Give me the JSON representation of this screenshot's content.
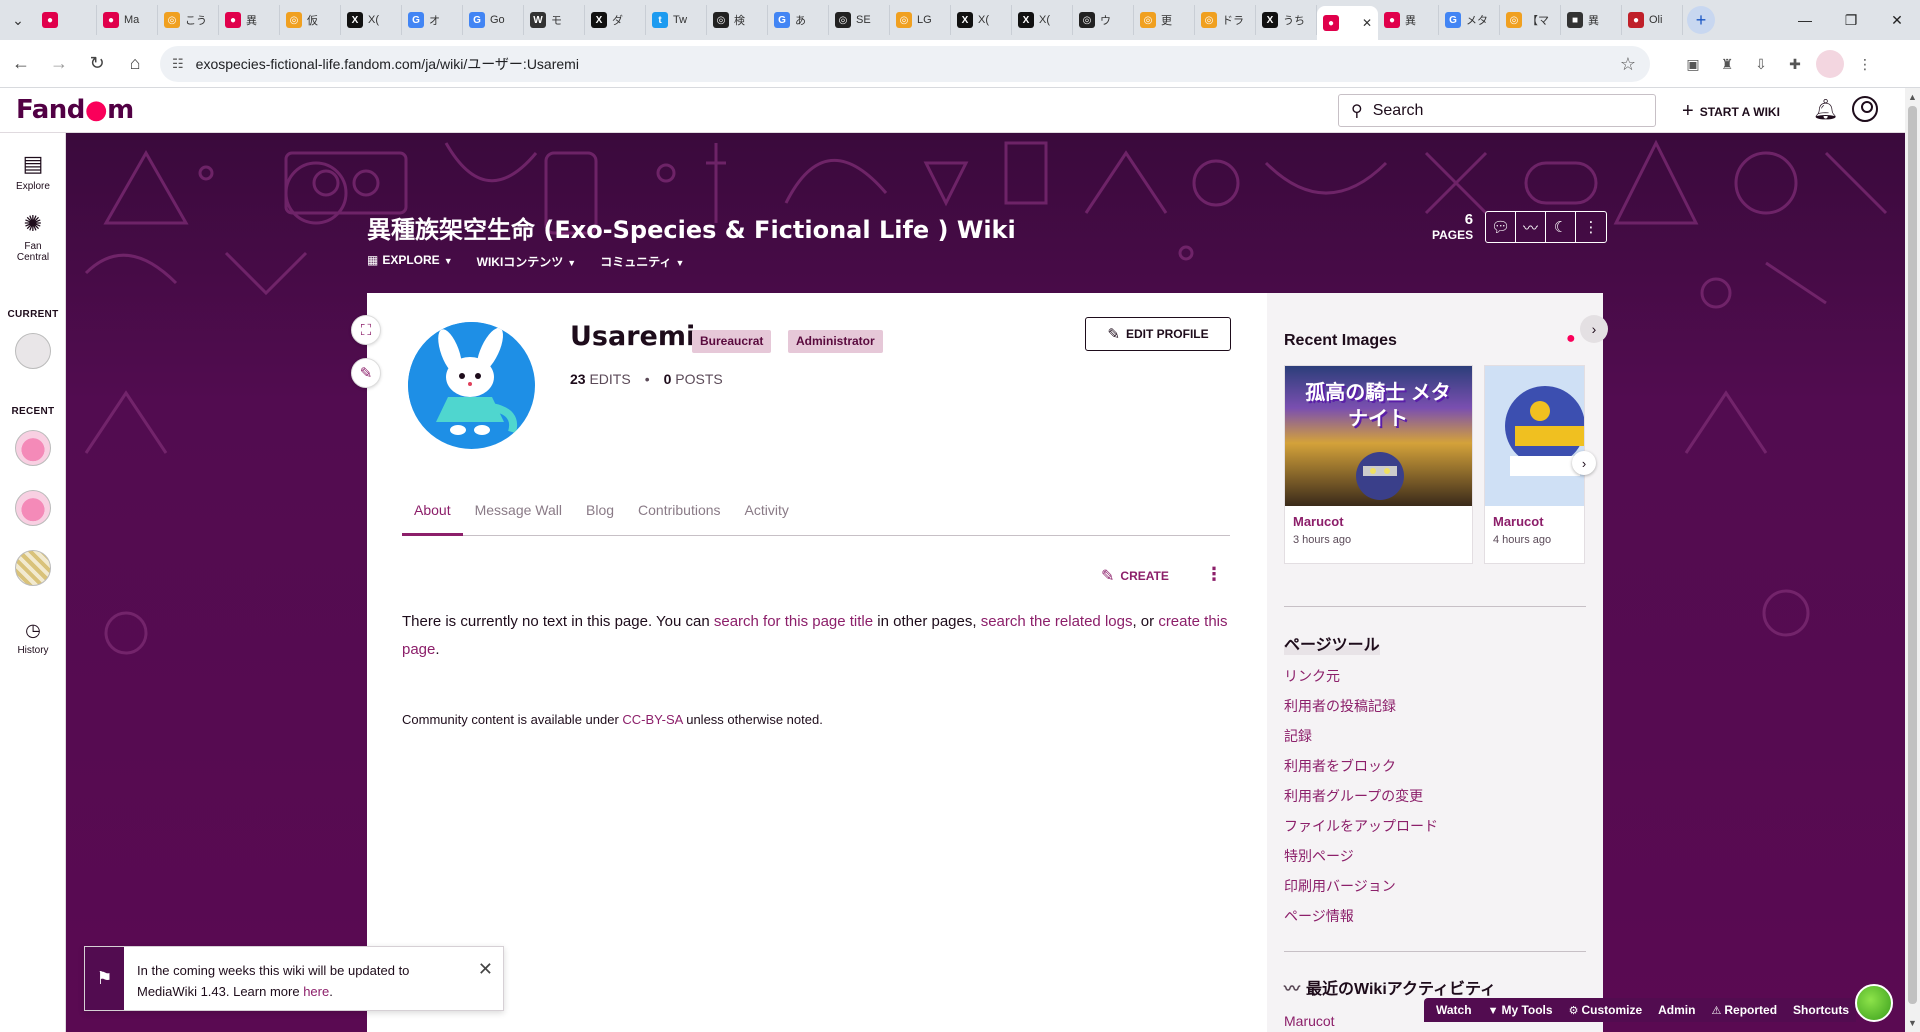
{
  "browser": {
    "tabs": [
      {
        "label": "",
        "fav_color": "#e0004b",
        "fav_glyph": "●"
      },
      {
        "label": "Ma",
        "fav_color": "#e0004b",
        "fav_glyph": "●"
      },
      {
        "label": "こう",
        "fav_color": "#f0a020",
        "fav_glyph": "◎"
      },
      {
        "label": "異",
        "fav_color": "#e0004b",
        "fav_glyph": "●"
      },
      {
        "label": "仮",
        "fav_color": "#f0a020",
        "fav_glyph": "◎"
      },
      {
        "label": "X(",
        "fav_color": "#111111",
        "fav_glyph": "X"
      },
      {
        "label": "オ",
        "fav_color": "#4285f4",
        "fav_glyph": "G"
      },
      {
        "label": "Go",
        "fav_color": "#4285f4",
        "fav_glyph": "G"
      },
      {
        "label": "モ",
        "fav_color": "#333333",
        "fav_glyph": "W"
      },
      {
        "label": "ダ",
        "fav_color": "#111111",
        "fav_glyph": "X"
      },
      {
        "label": "Tw",
        "fav_color": "#1d9bf0",
        "fav_glyph": "t"
      },
      {
        "label": "検",
        "fav_color": "#222222",
        "fav_glyph": "◎"
      },
      {
        "label": "あ",
        "fav_color": "#4285f4",
        "fav_glyph": "G"
      },
      {
        "label": "SE",
        "fav_color": "#222222",
        "fav_glyph": "◎"
      },
      {
        "label": "LG",
        "fav_color": "#f0a020",
        "fav_glyph": "◎"
      },
      {
        "label": "X(",
        "fav_color": "#111111",
        "fav_glyph": "X"
      },
      {
        "label": "X(",
        "fav_color": "#111111",
        "fav_glyph": "X"
      },
      {
        "label": "ウ",
        "fav_color": "#222222",
        "fav_glyph": "◎"
      },
      {
        "label": "更",
        "fav_color": "#f0a020",
        "fav_glyph": "◎"
      },
      {
        "label": "ドラ",
        "fav_color": "#f0a020",
        "fav_glyph": "◎"
      },
      {
        "label": "うち",
        "fav_color": "#111111",
        "fav_glyph": "X"
      },
      {
        "label": "",
        "fav_color": "#e0004b",
        "fav_glyph": "●",
        "active": true
      },
      {
        "label": "異",
        "fav_color": "#e0004b",
        "fav_glyph": "●"
      },
      {
        "label": "メタ",
        "fav_color": "#4285f4",
        "fav_glyph": "G"
      },
      {
        "label": "【マ",
        "fav_color": "#f0a020",
        "fav_glyph": "◎"
      },
      {
        "label": "異",
        "fav_color": "#333333",
        "fav_glyph": "■"
      },
      {
        "label": "Oli",
        "fav_color": "#c0202a",
        "fav_glyph": "●"
      }
    ],
    "url": "exospecies-fictional-life.fandom.com/ja/wiki/ユーザー:Usaremi"
  },
  "fandom": {
    "logo": "Fandom",
    "search_placeholder": "Search",
    "start_wiki": "START A WIKI"
  },
  "left_rail": {
    "explore": "Explore",
    "fan_central": "Fan Central",
    "current": "CURRENT",
    "recent": "RECENT",
    "history": "History"
  },
  "wiki": {
    "title": "異種族架空生命 (Exo-Species & Fictional Life ) Wiki",
    "nav": [
      "EXPLORE",
      "WIKIコンテンツ",
      "コミュニティ"
    ],
    "pages_num": "6",
    "pages_label": "PAGES"
  },
  "profile": {
    "username": "Usaremi",
    "badges": [
      "Bureaucrat",
      "Administrator"
    ],
    "edit_profile": "EDIT PROFILE",
    "edits_num": "23",
    "edits_label": "EDITS",
    "posts_num": "0",
    "posts_label": "POSTS",
    "tabs": [
      "About",
      "Message Wall",
      "Blog",
      "Contributions",
      "Activity"
    ]
  },
  "content": {
    "create": "CREATE",
    "text_1": "There is currently no text in this page. You can ",
    "link_1": "search for this page title",
    "text_2": " in other pages, ",
    "link_2": "search the related logs",
    "text_3": ", or ",
    "link_3": "create this page",
    "text_4": ".",
    "license_1": "Community content is available under ",
    "license_link": "CC-BY-SA",
    "license_2": " unless otherwise noted."
  },
  "rail": {
    "recent_images": "Recent Images",
    "images": [
      {
        "author": "Marucot",
        "when": "3 hours ago",
        "caption": "孤高の騎士 メタナイト"
      },
      {
        "author": "Marucot",
        "when": "4 hours ago"
      }
    ],
    "tools_title": "ページツール",
    "tools": [
      "リンク元",
      "利用者の投稿記録",
      "記録",
      "利用者をブロック",
      "利用者グループの変更",
      "ファイルをアップロード",
      "特別ページ",
      "印刷用バージョン",
      "ページ情報"
    ],
    "activity_title": "最近のWikiアクティビティ",
    "activity_user": "Marucot"
  },
  "notification": {
    "text": "In the coming weeks this wiki will be updated to MediaWiki 1.43. Learn more ",
    "link": "here",
    "end": "."
  },
  "bottom_bar": [
    "Watch",
    "My Tools",
    "Customize",
    "Admin",
    "Reported",
    "Shortcuts"
  ],
  "colors": {
    "brand": "#520c50",
    "link": "#8c1f6a",
    "fandom_accent": "#fa005a"
  }
}
